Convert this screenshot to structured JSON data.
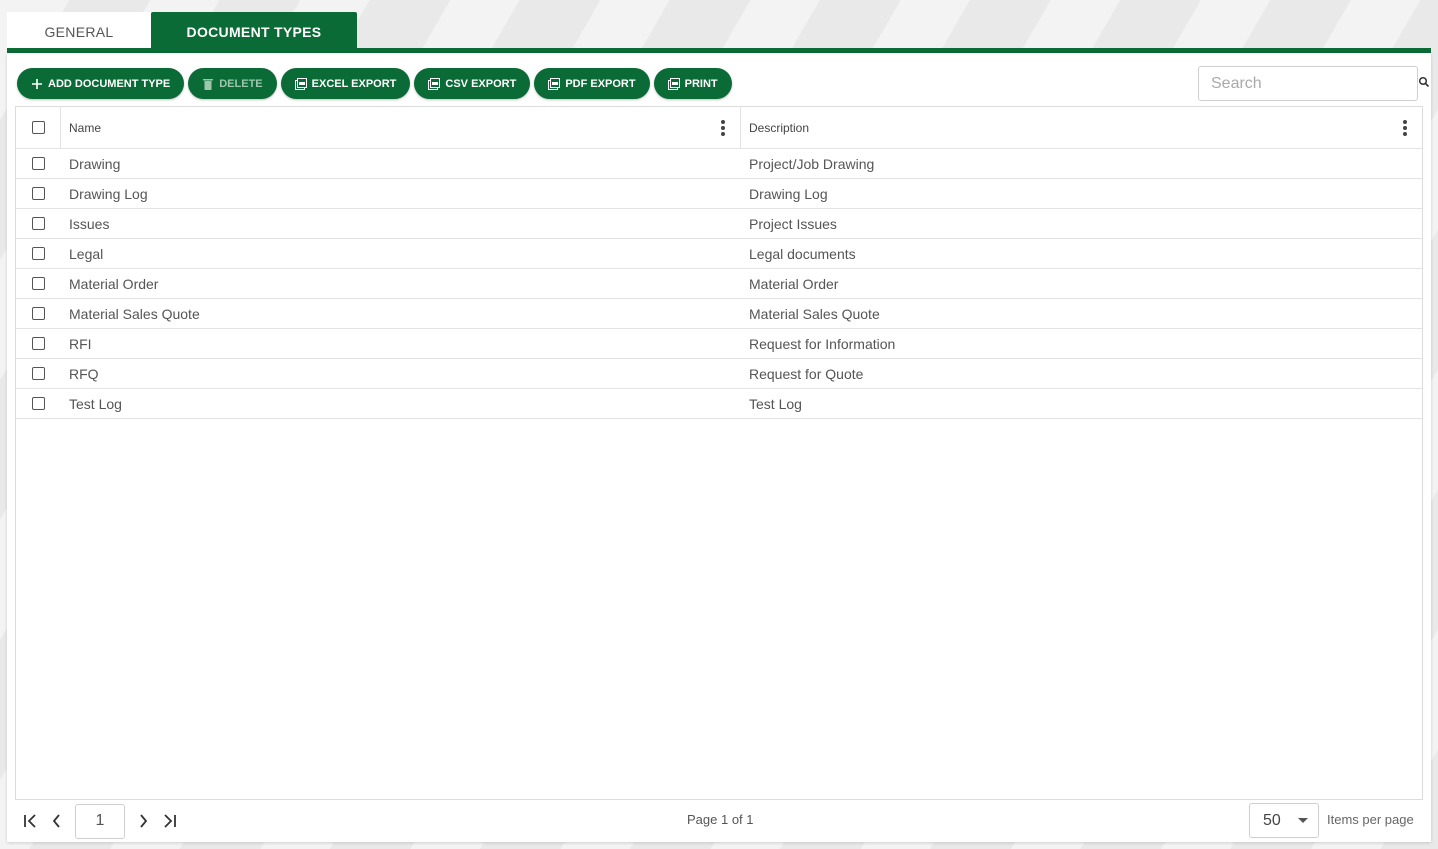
{
  "tabs": [
    {
      "label": "GENERAL",
      "active": false
    },
    {
      "label": "DOCUMENT TYPES",
      "active": true
    }
  ],
  "toolbar": {
    "add_label": "ADD DOCUMENT TYPE",
    "delete_label": "DELETE",
    "excel_label": "EXCEL EXPORT",
    "csv_label": "CSV EXPORT",
    "pdf_label": "PDF EXPORT",
    "print_label": "PRINT"
  },
  "search": {
    "placeholder": "Search",
    "value": ""
  },
  "grid": {
    "columns": [
      "Name",
      "Description"
    ],
    "rows": [
      {
        "name": "Drawing",
        "description": "Project/Job Drawing"
      },
      {
        "name": "Drawing Log",
        "description": "Drawing Log"
      },
      {
        "name": "Issues",
        "description": "Project Issues"
      },
      {
        "name": "Legal",
        "description": "Legal documents"
      },
      {
        "name": "Material Order",
        "description": "Material Order"
      },
      {
        "name": "Material Sales Quote",
        "description": "Material Sales Quote"
      },
      {
        "name": "RFI",
        "description": "Request for Information"
      },
      {
        "name": "RFQ",
        "description": "Request for Quote"
      },
      {
        "name": "Test Log",
        "description": "Test Log"
      }
    ]
  },
  "pager": {
    "current_page": "1",
    "info": "Page 1 of 1",
    "page_size": "50",
    "page_size_label": "Items per page"
  },
  "colors": {
    "brand": "#0b6b36",
    "disabled_text": "#9cc7ad"
  },
  "icons": {
    "add": "plus-icon",
    "delete": "trash-icon",
    "export": "export-file-icon",
    "search": "search-icon",
    "column_menu": "kebab-icon",
    "first": "first-page-icon",
    "prev": "chevron-left-icon",
    "next": "chevron-right-icon",
    "last": "last-page-icon",
    "dropdown": "caret-down-icon"
  }
}
